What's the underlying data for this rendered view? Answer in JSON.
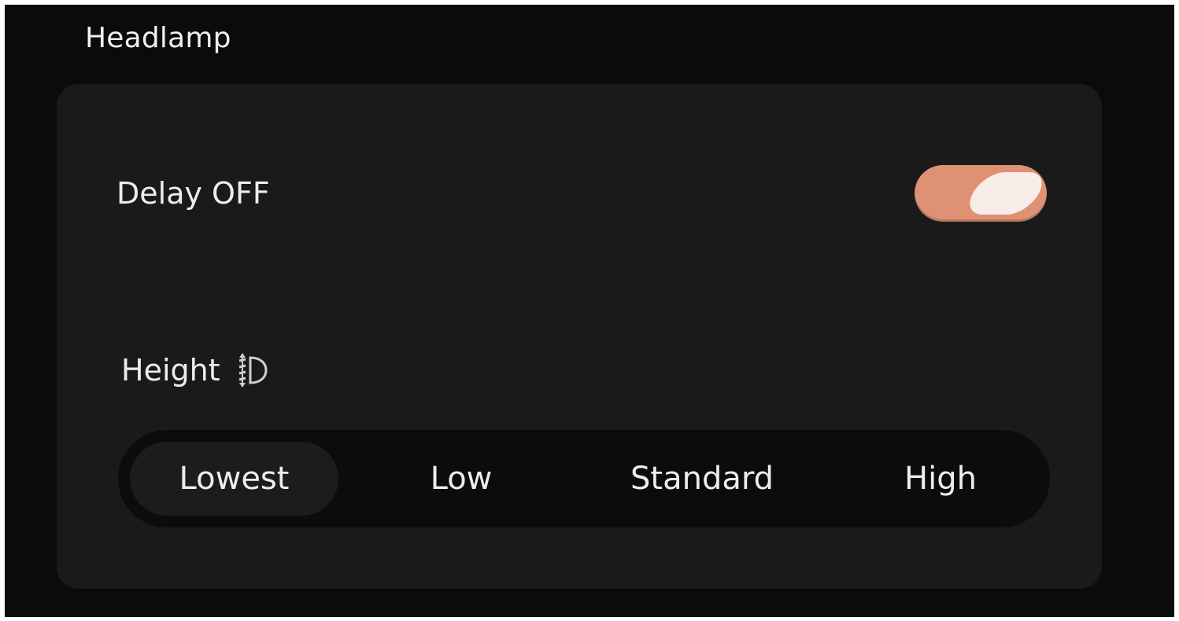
{
  "section": {
    "title": "Headlamp"
  },
  "delay": {
    "label": "Delay OFF",
    "enabled": true,
    "accent_color": "#df9273"
  },
  "height": {
    "label": "Height",
    "icon": "headlamp-leveling-icon",
    "options": [
      "Lowest",
      "Low",
      "Standard",
      "High"
    ],
    "selected": "Lowest"
  }
}
